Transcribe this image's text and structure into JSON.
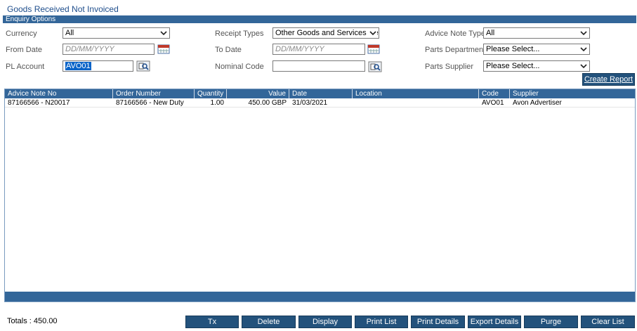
{
  "window": {
    "title": "Goods Received Not Invoiced"
  },
  "section": {
    "title": "Enquiry Options"
  },
  "filters": {
    "currency": {
      "label": "Currency",
      "value": "All"
    },
    "receipt_types": {
      "label": "Receipt Types",
      "value": "Other Goods and Services Receip"
    },
    "advice_note_types": {
      "label": "Advice Note Types",
      "value": "All"
    },
    "from_date": {
      "label": "From Date",
      "placeholder": "DD/MM/YYYY"
    },
    "to_date": {
      "label": "To Date",
      "placeholder": "DD/MM/YYYY"
    },
    "parts_department": {
      "label": "Parts Department",
      "value": "Please Select..."
    },
    "pl_account": {
      "label": "PL Account",
      "value": "AVO01"
    },
    "nominal_code": {
      "label": "Nominal Code",
      "value": ""
    },
    "parts_supplier": {
      "label": "Parts Supplier",
      "value": "Please Select..."
    }
  },
  "create_report_label": "Create Report",
  "grid": {
    "columns": [
      "Advice Note No",
      "Order Number",
      "Quantity",
      "Value",
      "Date",
      "Location",
      "Code",
      "Supplier"
    ],
    "rows": [
      {
        "advice_note_no": "87166566 - N20017",
        "order_number": "87166566 - New Duty",
        "quantity": "1.00",
        "value": "450.00 GBP",
        "date": "31/03/2021",
        "location": "",
        "code": "AVO01",
        "supplier": "Avon Advertiser"
      }
    ]
  },
  "footer": {
    "totals": "Totals : 450.00",
    "buttons": [
      "Tx",
      "Delete",
      "Display Contents",
      "Print List",
      "Print Details",
      "Export Details",
      "Purge",
      "Clear List"
    ]
  },
  "colors": {
    "header_bar": "#336699",
    "button": "#23527c",
    "selection": "#0a64c8"
  },
  "icons": [
    "calendar-icon",
    "lookup-icon",
    "chevron-down-icon"
  ]
}
